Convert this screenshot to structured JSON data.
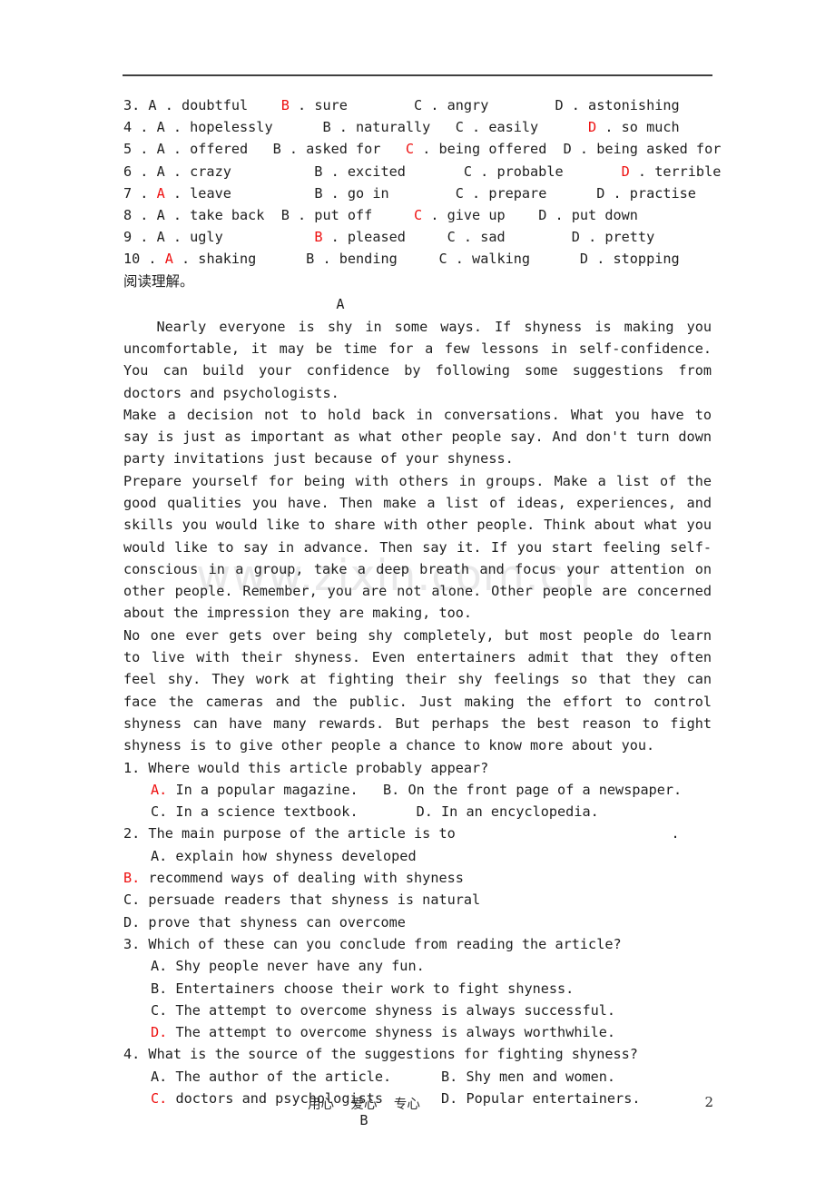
{
  "document": {
    "page_number": "2",
    "footer_motto": "用心    爱心    专心",
    "watermark": "www.zixin.com.cn"
  },
  "cloze": {
    "items": [
      {
        "number": "3. ",
        "answer": "B",
        "segments": [
          {
            "text": "3. A . doubtful    ",
            "red": false
          },
          {
            "text": "B",
            "red": true
          },
          {
            "text": " . sure        C . angry        D . astonishing",
            "red": false
          }
        ]
      },
      {
        "number": "4 . ",
        "answer": "D",
        "segments": [
          {
            "text": "4 . A . hopelessly      B . naturally   C . easily      ",
            "red": false
          },
          {
            "text": "D",
            "red": true
          },
          {
            "text": " . so much",
            "red": false
          }
        ]
      },
      {
        "number": "5 . ",
        "answer": "C",
        "segments": [
          {
            "text": "5 . A . offered   B . asked for   ",
            "red": false
          },
          {
            "text": "C",
            "red": true
          },
          {
            "text": " . being offered  D . being asked for",
            "red": false
          }
        ]
      },
      {
        "number": "6 . ",
        "answer": "D",
        "segments": [
          {
            "text": "6 . A . crazy          B . excited       C . probable       ",
            "red": false
          },
          {
            "text": "D",
            "red": true
          },
          {
            "text": " . terrible",
            "red": false
          }
        ]
      },
      {
        "number": "7 . ",
        "answer": "A",
        "segments": [
          {
            "text": "7 . ",
            "red": false
          },
          {
            "text": "A",
            "red": true
          },
          {
            "text": " . leave          B . go in        C . prepare      D . practise",
            "red": false
          }
        ]
      },
      {
        "number": "8 . ",
        "answer": "C",
        "segments": [
          {
            "text": "8 . A . take back  B . put off     ",
            "red": false
          },
          {
            "text": "C",
            "red": true
          },
          {
            "text": " . give up    D . put down",
            "red": false
          }
        ]
      },
      {
        "number": "9 . ",
        "answer": "B",
        "segments": [
          {
            "text": "9 . A . ugly           ",
            "red": false
          },
          {
            "text": "B",
            "red": true
          },
          {
            "text": " . pleased     C . sad        D . pretty",
            "red": false
          }
        ]
      },
      {
        "number": "10 . ",
        "answer": "A",
        "segments": [
          {
            "text": "10 . ",
            "red": false
          },
          {
            "text": "A",
            "red": true
          },
          {
            "text": " . shaking      B . bending     C . walking      D . stopping",
            "red": false
          }
        ]
      }
    ]
  },
  "reading": {
    "section_heading": "阅读理解。",
    "passage_a_label": "A",
    "passage_b_label": "B",
    "paragraphs": [
      "Nearly everyone is shy in some ways. If shyness is making you uncomfortable, it may be time for a few lessons in self-confidence. You can build your confidence by following some suggestions from doctors and psychologists.",
      "Make a decision not to hold back in conversations. What you have to say is just as important as what other people say. And don't turn down party invitations just because of your shyness.",
      "Prepare yourself for being with others in groups. Make a list of the good qualities you have. Then make a list of ideas, experiences, and skills you would like to share with other people. Think about what you would like to say in advance. Then say it. If you start feeling self-conscious in a group, take a deep breath and focus your attention on other people. Remember, you are not alone. Other people are concerned about the impression they are making, too.",
      "No one ever gets over being shy completely, but most people do learn to live with their shyness. Even entertainers admit that they often feel shy. They work at fighting their shy feelings so that they can face the cameras and the public. Just making the effort to control shyness can have many rewards. But perhaps the best reason to fight shyness is to give other people a chance to know more about you."
    ],
    "questions": [
      {
        "stem": "1. Where would this article probably appear?",
        "answer": "A",
        "options": [
          {
            "indent": true,
            "segments": [
              {
                "text": "A.",
                "red": true
              },
              {
                "text": " In a popular magazine.   B. On the front page of a newspaper.",
                "red": false
              }
            ]
          },
          {
            "indent": true,
            "segments": [
              {
                "text": "C. In a science textbook.       D. In an encyclopedia.",
                "red": false
              }
            ]
          }
        ]
      },
      {
        "stem": "2. The main purpose of the article is to                          .",
        "answer": "B",
        "options": [
          {
            "indent": true,
            "segments": [
              {
                "text": "A. explain how shyness developed",
                "red": false
              }
            ]
          },
          {
            "indent": false,
            "segments": [
              {
                "text": "B.",
                "red": true
              },
              {
                "text": " recommend ways of dealing with shyness",
                "red": false
              }
            ]
          },
          {
            "indent": false,
            "segments": [
              {
                "text": "C. persuade readers that shyness is natural",
                "red": false
              }
            ]
          },
          {
            "indent": false,
            "segments": [
              {
                "text": "D. prove that shyness can overcome",
                "red": false
              }
            ]
          }
        ]
      },
      {
        "stem": "3. Which of these can you conclude from reading the article?",
        "answer": "D",
        "options": [
          {
            "indent": true,
            "segments": [
              {
                "text": "A. Shy people never have any fun.",
                "red": false
              }
            ]
          },
          {
            "indent": true,
            "segments": [
              {
                "text": "B. Entertainers choose their work to fight shyness.",
                "red": false
              }
            ]
          },
          {
            "indent": true,
            "segments": [
              {
                "text": "C. The attempt to overcome shyness is always successful.",
                "red": false
              }
            ]
          },
          {
            "indent": true,
            "segments": [
              {
                "text": "D.",
                "red": true
              },
              {
                "text": " The attempt to overcome shyness is always worthwhile.",
                "red": false
              }
            ]
          }
        ]
      },
      {
        "stem": "4. What is the source of the suggestions for fighting shyness?",
        "answer": "C",
        "options": [
          {
            "indent": true,
            "segments": [
              {
                "text": "A. The author of the article.      B. Shy men and women.",
                "red": false
              }
            ]
          },
          {
            "indent": true,
            "segments": [
              {
                "text": "C.",
                "red": true
              },
              {
                "text": " doctors and psychologists       D. Popular entertainers.",
                "red": false
              }
            ]
          }
        ]
      }
    ]
  },
  "colors": {
    "answer_red": "#ee1111",
    "text": "#1f1f1f",
    "rule": "#3f3f3f",
    "watermark": "#e9e9ea"
  }
}
